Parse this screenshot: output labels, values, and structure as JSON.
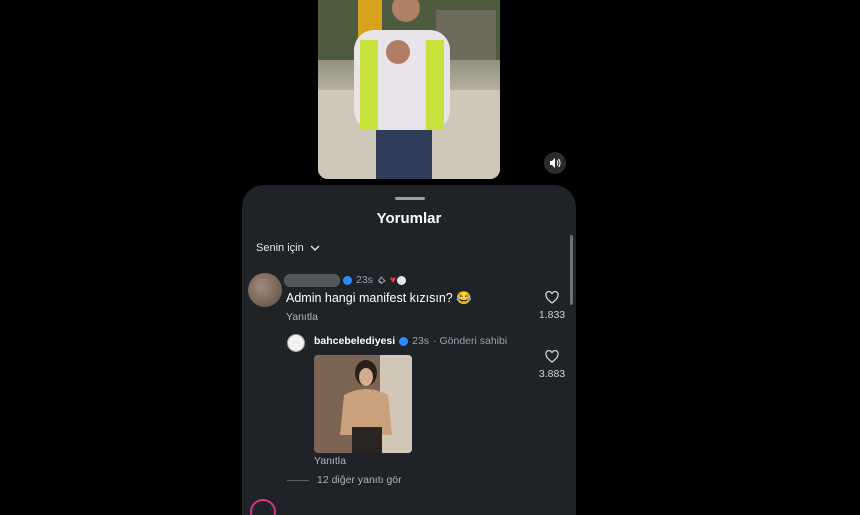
{
  "comments_sheet": {
    "title": "Yorumlar",
    "filter_label": "Senin için",
    "comment": {
      "time": "23s",
      "text": "Admin hangi manifest kızısın? 😂",
      "reply_label": "Yanıtla",
      "likes": "1.833"
    },
    "reply": {
      "username": "bahcebelediyesi",
      "time": "23s",
      "tag": "· Gönderi sahibi",
      "reply_label": "Yanıtla",
      "likes": "3.883"
    },
    "view_more": "12 diğer yanıtı gör"
  },
  "colors": {
    "sheet_bg": "#1f2328",
    "verified": "#2f8cff",
    "heart_red": "#ff3040"
  },
  "icons": [
    "volume-icon",
    "chevron-down-icon",
    "heart-outline-icon",
    "pin-icon",
    "verified-badge-icon"
  ]
}
